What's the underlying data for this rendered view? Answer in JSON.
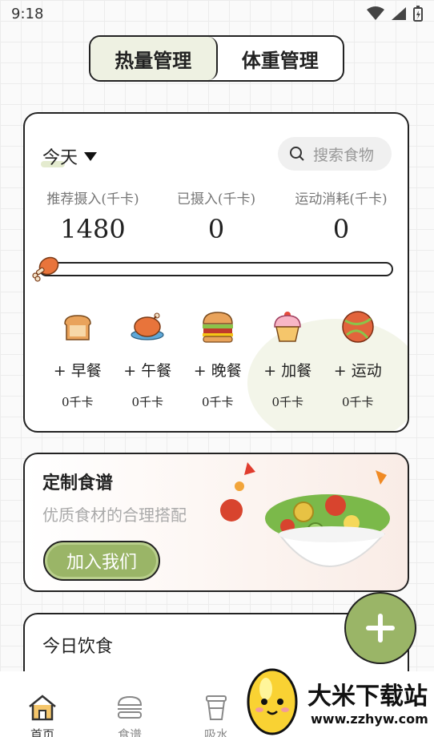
{
  "status_bar": {
    "time": "9:18"
  },
  "tabs": [
    {
      "label": "热量管理",
      "active": true
    },
    {
      "label": "体重管理",
      "active": false
    }
  ],
  "summary": {
    "day_label": "今天",
    "search_placeholder": "搜索食物",
    "stats": [
      {
        "label": "推荐摄入(千卡)",
        "value": "1480"
      },
      {
        "label": "已摄入(千卡)",
        "value": "0"
      },
      {
        "label": "运动消耗(千卡)",
        "value": "0"
      }
    ],
    "progress_fraction": 0,
    "meals": [
      {
        "icon": "bread-icon",
        "label": "+ 早餐",
        "kcal": "0千卡"
      },
      {
        "icon": "roast-chicken-icon",
        "label": "+ 午餐",
        "kcal": "0千卡"
      },
      {
        "icon": "burger-icon",
        "label": "+ 晚餐",
        "kcal": "0千卡"
      },
      {
        "icon": "cupcake-icon",
        "label": "+ 加餐",
        "kcal": "0千卡"
      },
      {
        "icon": "ball-icon",
        "label": "+ 运动",
        "kcal": "0千卡"
      }
    ]
  },
  "banner": {
    "title": "定制食谱",
    "subtitle": "优质食材的合理搭配",
    "button_label": "加入我们"
  },
  "today": {
    "title": "今日饮食"
  },
  "fab_icon": "plus-icon",
  "bottom_nav": [
    {
      "label": "首页",
      "icon": "home-icon",
      "active": true
    },
    {
      "label": "食谱",
      "icon": "burger-outline-icon",
      "active": false
    },
    {
      "label": "吸水",
      "icon": "cup-icon",
      "active": false
    }
  ],
  "watermark": {
    "name": "大米下载站",
    "url": "www.zzhyw.com"
  },
  "colors": {
    "accent_green": "#9ab567",
    "tab_active_bg": "#eef1e2",
    "border": "#222222"
  }
}
